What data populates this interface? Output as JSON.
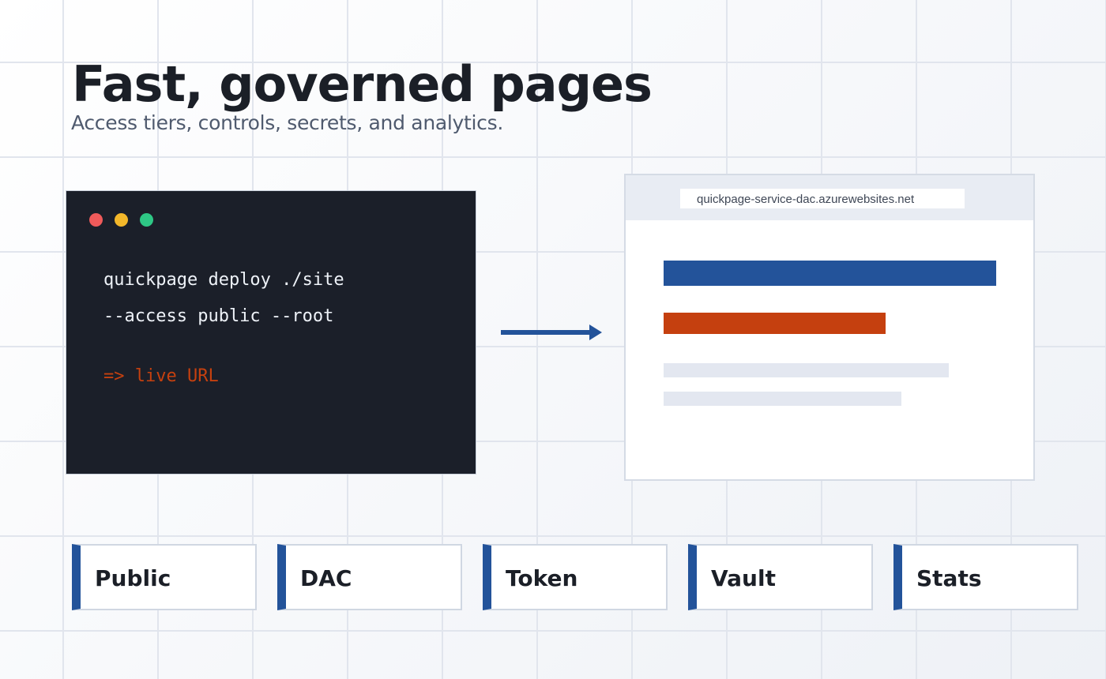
{
  "header": {
    "title": "Fast, governed pages",
    "subtitle": "Access tiers, controls, secrets, and analytics."
  },
  "terminal": {
    "lines": [
      "quickpage deploy ./site",
      "--access public --root"
    ],
    "result": "=> live URL"
  },
  "browser": {
    "url": "quickpage-service-dac.azurewebsites.net"
  },
  "features": [
    {
      "label": "Public"
    },
    {
      "label": "DAC"
    },
    {
      "label": "Token"
    },
    {
      "label": "Vault"
    },
    {
      "label": "Stats"
    }
  ],
  "colors": {
    "accent": "#23539a",
    "highlight": "#c5400f",
    "terminal_bg": "#1b1f29",
    "text": "#1b1f27"
  },
  "icons": {
    "flow": "right-arrow-icon"
  }
}
